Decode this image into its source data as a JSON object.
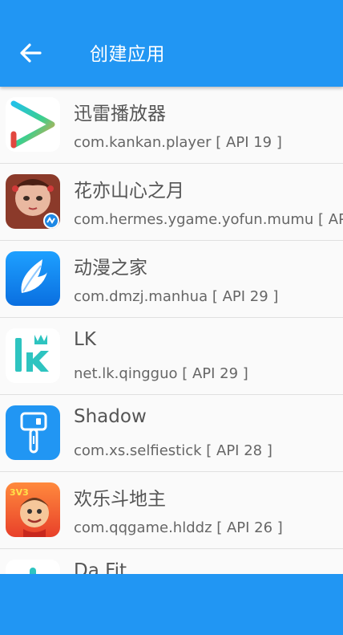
{
  "header": {
    "title": "创建应用",
    "back_icon": "arrow-left-icon"
  },
  "apps": [
    {
      "name": "迅雷播放器",
      "package": "com.kankan.player [ API 19 ]",
      "icon": "play-triangle-icon"
    },
    {
      "name": "花亦山心之月",
      "package": "com.hermes.ygame.yofun.mumu [ AP",
      "icon": "game-character-icon"
    },
    {
      "name": "动漫之家",
      "package": "com.dmzj.manhua [ API 29 ]",
      "icon": "wing-icon"
    },
    {
      "name": "LK",
      "package": "net.lk.qingguo [ API 29 ]",
      "icon": "lk-logo-icon"
    },
    {
      "name": "Shadow",
      "package": "com.xs.selfiestick [ API 28 ]",
      "icon": "selfie-stick-icon"
    },
    {
      "name": "欢乐斗地主",
      "package": "com.qqgame.hlddz [ API 26 ]",
      "icon": "landlord-game-icon"
    },
    {
      "name": "Da Fit",
      "package": "",
      "icon": "dafit-icon"
    }
  ],
  "colors": {
    "primary": "#2196f3",
    "background": "#fafafa",
    "divider": "#e0e0e0",
    "text_primary": "#555555",
    "text_secondary": "#666666"
  }
}
